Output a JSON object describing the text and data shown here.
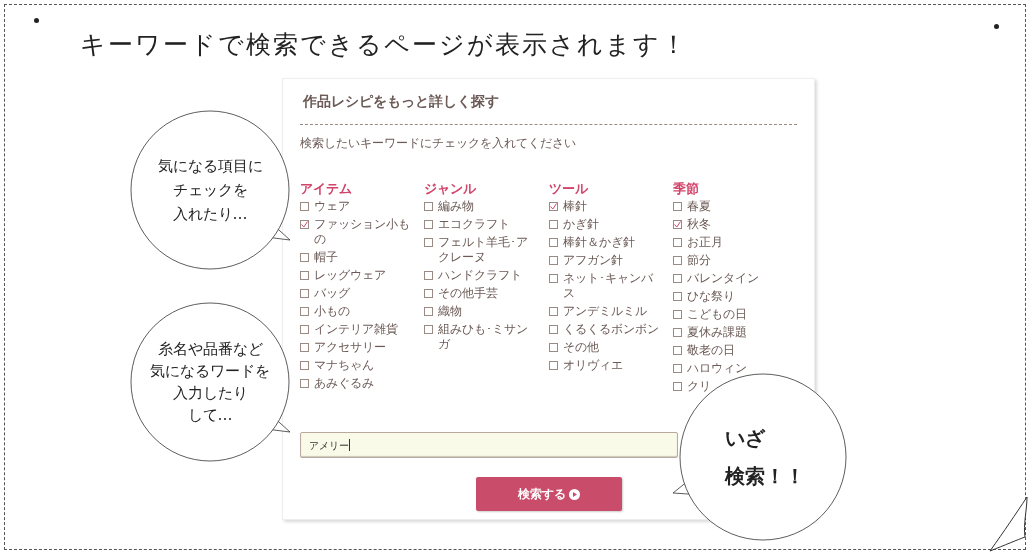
{
  "headline": "キーワードで検索できるページが表示されます！",
  "card": {
    "title": "作品レシピをもっと詳しく探す",
    "instruction": "検索したいキーワードにチェックを入れてください",
    "columns": [
      {
        "heading": "アイテム",
        "items": [
          {
            "label": "ウェア",
            "checked": false
          },
          {
            "label": "ファッション小もの",
            "checked": true
          },
          {
            "label": "帽子",
            "checked": false
          },
          {
            "label": "レッグウェア",
            "checked": false
          },
          {
            "label": "バッグ",
            "checked": false
          },
          {
            "label": "小もの",
            "checked": false
          },
          {
            "label": "インテリア雑貨",
            "checked": false
          },
          {
            "label": "アクセサリー",
            "checked": false
          },
          {
            "label": "マナちゃん",
            "checked": false
          },
          {
            "label": "あみぐるみ",
            "checked": false
          }
        ]
      },
      {
        "heading": "ジャンル",
        "items": [
          {
            "label": "編み物",
            "checked": false
          },
          {
            "label": "エコクラフト",
            "checked": false
          },
          {
            "label": "フェルト羊毛･アクレーヌ",
            "checked": false
          },
          {
            "label": "ハンドクラフト",
            "checked": false
          },
          {
            "label": "その他手芸",
            "checked": false
          },
          {
            "label": "織物",
            "checked": false
          },
          {
            "label": "組みひも･ミサンガ",
            "checked": false
          }
        ]
      },
      {
        "heading": "ツール",
        "items": [
          {
            "label": "棒針",
            "checked": true
          },
          {
            "label": "かぎ針",
            "checked": false
          },
          {
            "label": "棒針＆かぎ針",
            "checked": false
          },
          {
            "label": "アフガン針",
            "checked": false
          },
          {
            "label": "ネット･キャンバス",
            "checked": false
          },
          {
            "label": "アンデミルミル",
            "checked": false
          },
          {
            "label": "くるくるボンボン",
            "checked": false
          },
          {
            "label": "その他",
            "checked": false
          },
          {
            "label": "オリヴィエ",
            "checked": false
          }
        ]
      },
      {
        "heading": "季節",
        "items": [
          {
            "label": "春夏",
            "checked": false
          },
          {
            "label": "秋冬",
            "checked": true
          },
          {
            "label": "お正月",
            "checked": false
          },
          {
            "label": "節分",
            "checked": false
          },
          {
            "label": "バレンタイン",
            "checked": false
          },
          {
            "label": "ひな祭り",
            "checked": false
          },
          {
            "label": "こどもの日",
            "checked": false
          },
          {
            "label": "夏休み課題",
            "checked": false
          },
          {
            "label": "敬老の日",
            "checked": false
          },
          {
            "label": "ハロウィン",
            "checked": false
          },
          {
            "label": "クリ",
            "checked": false
          }
        ]
      }
    ],
    "search": {
      "value": "アメリー"
    },
    "button": "検索する"
  },
  "bubbles": [
    {
      "lines": [
        "気になる項目に",
        "チェックを",
        "入れたり…"
      ]
    },
    {
      "lines": [
        "糸名や品番など",
        "気になるワードを",
        "入力したり",
        "して…"
      ]
    },
    {
      "lines": [
        "いざ",
        "検索！！"
      ]
    }
  ]
}
